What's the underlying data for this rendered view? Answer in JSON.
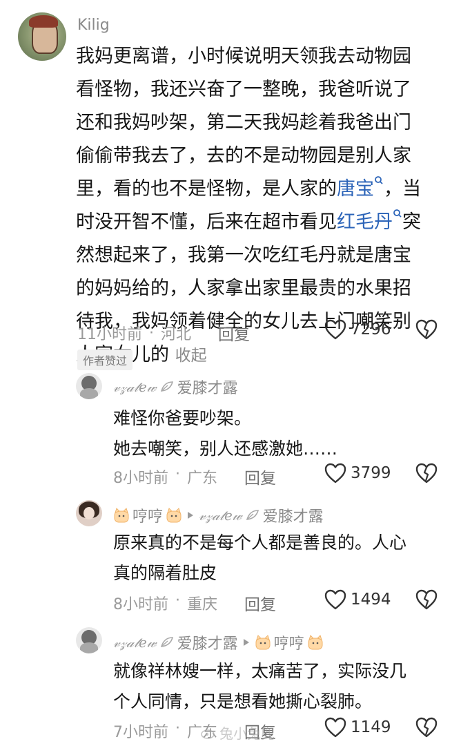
{
  "main_comment": {
    "username": "Kilig",
    "lines": [
      "我妈更离谱，小时候说明天领我去动物园",
      "看怪物，我还兴奋了一整晚，我爸听说了",
      "还和我妈吵架，第二天我妈趁着我爸出门",
      "偷偷带我去了，去的不是动物园是别人家"
    ],
    "line5_pre": "里，看的也不是怪物，是人家的",
    "line5_link": "唐宝",
    "line5_post": "，当",
    "line6_pre": "时没开智不懂，后来在超市看见",
    "line6_link": "红毛丹",
    "line6_post": "突",
    "lines_after": [
      "然想起来了，我第一次吃红毛丹就是唐宝",
      "的妈妈给的，人家拿出家里最贵的水果招",
      "待我，我妈领着健全的女儿去上门嘲笑别"
    ],
    "last_line": "人家女儿的",
    "collapse": "收起",
    "time": "11小时前",
    "dot": "·",
    "location": "河北",
    "reply": "回复",
    "likes": "7296",
    "author_badge": "作者赞过"
  },
  "replies": [
    {
      "user": "爱膝才露",
      "text_lines": [
        "难怪你爸要吵架。",
        "她去嘲笑，别人还感激她……"
      ],
      "time": "8小时前",
      "location": "广东",
      "reply": "回复",
      "likes": "3799"
    },
    {
      "user": "哼哼",
      "reply_to": "爱膝才露",
      "text_lines": [
        "原来真的不是每个人都是善良的。人心",
        "真的隔着肚皮"
      ],
      "time": "8小时前",
      "location": "重庆",
      "reply": "回复",
      "likes": "1494"
    },
    {
      "user": "爱膝才露",
      "reply_to": "哼哼",
      "text_lines": [
        "就像祥林嫂一样，太痛苦了，实际没几",
        "个人同情，只是想看她撕心裂肺。"
      ],
      "time": "7小时前",
      "location": "广东",
      "reply": "回复",
      "likes": "1149"
    }
  ],
  "watermark": "兔小兔兜",
  "colors": {
    "link": "#2c64b8",
    "meta": "#9a9a9a",
    "text": "#161616"
  }
}
